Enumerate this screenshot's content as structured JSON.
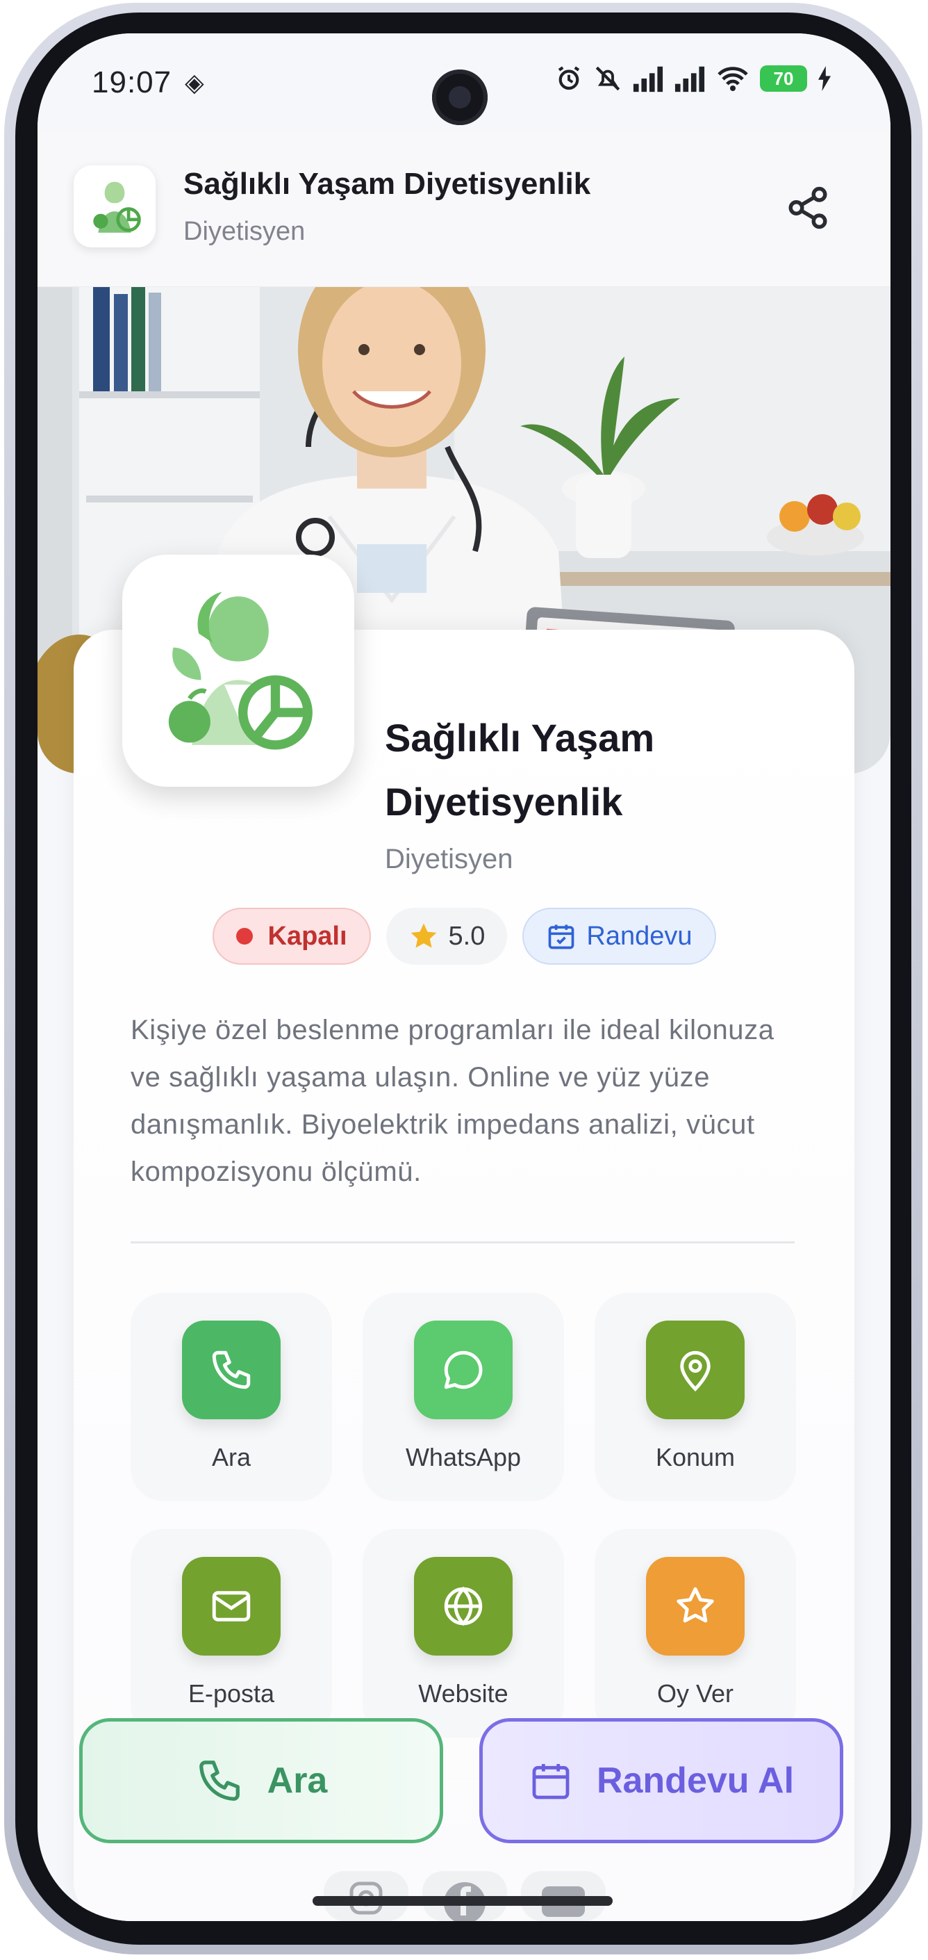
{
  "status_bar": {
    "time": "19:07",
    "battery": "70"
  },
  "appbar": {
    "title": "Sağlıklı Yaşam Diyetisyenlik",
    "subtitle": "Diyetisyen"
  },
  "profile": {
    "name_line1": "Sağlıklı Yaşam",
    "name_line2": "Diyetisyenlik",
    "category": "Diyetisyen"
  },
  "badges": {
    "status": "Kapalı",
    "rating": "5.0",
    "appointment": "Randevu"
  },
  "description": "Kişiye özel beslenme programları ile ideal kilonuza ve sağlıklı yaşama ulaşın. Online ve yüz yüze danışmanlık. Biyoelektrik impedans analizi, vücut kompozisyonu ölçümü.",
  "actions": [
    {
      "label": "Ara",
      "icon": "phone-icon",
      "color": "#4cb865"
    },
    {
      "label": "WhatsApp",
      "icon": "chat-bubble-icon",
      "color": "#5cca6e"
    },
    {
      "label": "Konum",
      "icon": "map-pin-icon",
      "color": "#73a22e"
    },
    {
      "label": "E-posta",
      "icon": "mail-icon",
      "color": "#73a22e"
    },
    {
      "label": "Website",
      "icon": "globe-icon",
      "color": "#73a22e"
    },
    {
      "label": "Oy Ver",
      "icon": "star-icon",
      "color": "#ee9d37"
    }
  ],
  "bottom_buttons": {
    "call": "Ara",
    "appointment": "Randevu Al"
  },
  "colors": {
    "brand_green": "#5fae56",
    "closed_red": "#e23b3b",
    "appointment_blue": "#2f62d5",
    "purple": "#6b5fe0"
  }
}
